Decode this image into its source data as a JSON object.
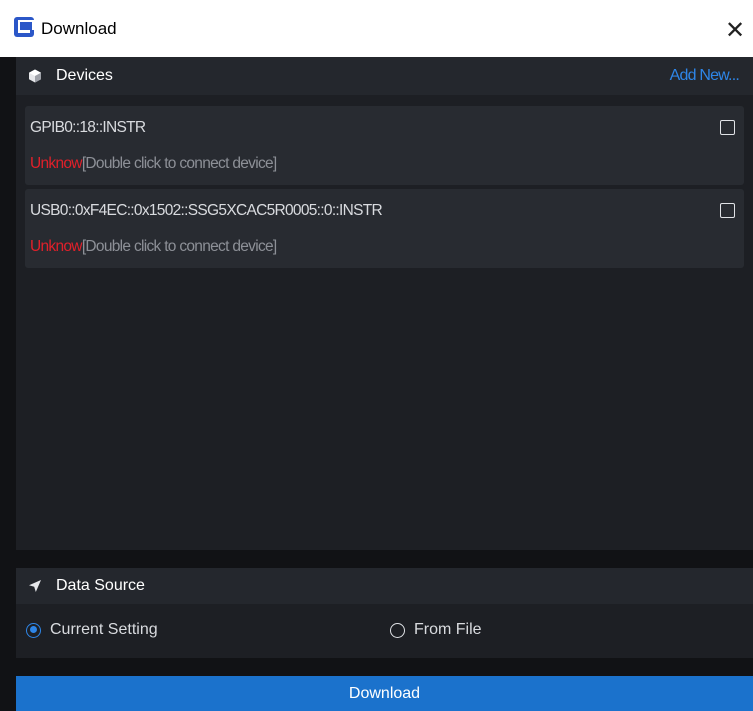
{
  "window": {
    "title": "Download",
    "close_glyph": "✕",
    "icon": "app-logo-icon"
  },
  "devices": {
    "title": "Devices",
    "add_link": "Add New...",
    "header_icon": "cube-icon",
    "items": [
      {
        "address": "GPIB0::18::INSTR",
        "status": "Unknow",
        "hint": "[Double click to connect device]",
        "checked": false
      },
      {
        "address": "USB0::0xF4EC::0x1502::SSG5XCAC5R0005::0::INSTR",
        "status": "Unknow",
        "hint": "[Double click to connect device]",
        "checked": false
      }
    ]
  },
  "data_source": {
    "title": "Data Source",
    "header_icon": "send-arrow-icon",
    "options": [
      {
        "label": "Current Setting",
        "selected": true
      },
      {
        "label": "From File",
        "selected": false
      }
    ]
  },
  "actions": {
    "download_label": "Download"
  },
  "colors": {
    "accent": "#2e86e8",
    "button": "#1b72cc",
    "status_unknown": "#e0202a",
    "background": "#111215",
    "panel": "#1d1f24"
  }
}
